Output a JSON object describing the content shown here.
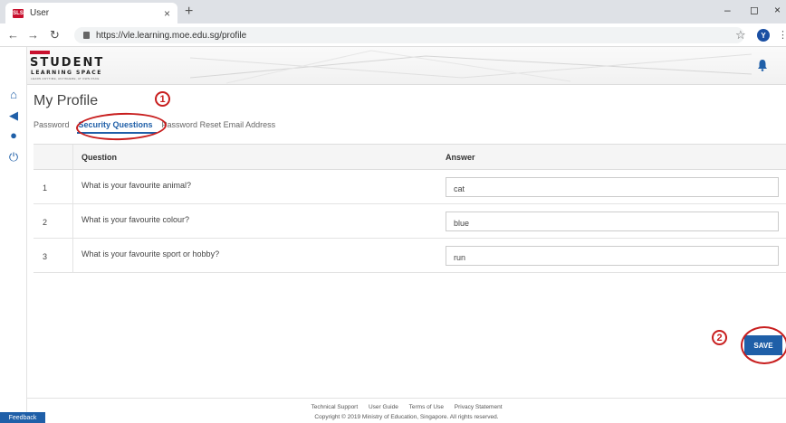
{
  "browser": {
    "tab_title": "User",
    "favicon_text": "SLS",
    "url": "https://vle.learning.moe.edu.sg/profile",
    "profile_initial": "Y"
  },
  "header": {
    "logo_main": "STUDENT",
    "logo_sub": "LEARNING SPACE",
    "logo_tag": "LEARN ANYTIME, ANYWHERE, AT OWN PACE"
  },
  "page": {
    "title": "My Profile",
    "tabs": [
      {
        "label": "Password",
        "active": false
      },
      {
        "label": "Security Questions",
        "active": true
      },
      {
        "label": "Password Reset Email Address",
        "active": false
      }
    ]
  },
  "table": {
    "headers": {
      "question": "Question",
      "answer": "Answer"
    },
    "rows": [
      {
        "num": "1",
        "question": "What is your favourite animal?",
        "answer": "cat"
      },
      {
        "num": "2",
        "question": "What is your favourite colour?",
        "answer": "blue"
      },
      {
        "num": "3",
        "question": "What is your favourite sport or hobby?",
        "answer": "run"
      }
    ]
  },
  "buttons": {
    "save": "SAVE"
  },
  "annotations": {
    "first": "1",
    "second": "2"
  },
  "footer": {
    "links": [
      "Technical Support",
      "User Guide",
      "Terms of Use",
      "Privacy Statement"
    ],
    "copyright": "Copyright © 2019 Ministry of Education, Singapore. All rights reserved."
  },
  "feedback_label": "Feedback",
  "colors": {
    "accent": "#1f5fa8",
    "annotation": "#c81e1e",
    "brand": "#c8102e"
  }
}
